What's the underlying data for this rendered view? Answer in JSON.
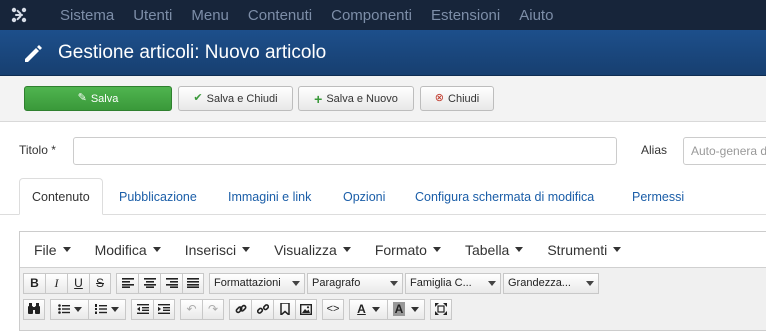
{
  "topnav": {
    "items": [
      "Sistema",
      "Utenti",
      "Menu",
      "Contenuti",
      "Componenti",
      "Estensioni",
      "Aiuto"
    ]
  },
  "header": {
    "title": "Gestione articoli: Nuovo articolo"
  },
  "toolbar": {
    "save": "Salva",
    "save_close": "Salva e Chiudi",
    "save_new": "Salva e Nuovo",
    "close": "Chiudi"
  },
  "form": {
    "title_label": "Titolo *",
    "title_value": "",
    "alias_label": "Alias",
    "alias_placeholder": "Auto-genera d"
  },
  "tabs": [
    "Contenuto",
    "Pubblicazione",
    "Immagini e link",
    "Opzioni",
    "Configura schermata di modifica",
    "Permessi"
  ],
  "editor": {
    "menu": [
      "File",
      "Modifica",
      "Inserisci",
      "Visualizza",
      "Formato",
      "Tabella",
      "Strumenti"
    ],
    "formats": "Formattazioni",
    "block": "Paragrafo",
    "font_family": "Famiglia C...",
    "font_size": "Grandezza..."
  },
  "colors": {
    "topnav_bg": "#17253a",
    "header_bg": "#1d4f8b",
    "save_green": "#3fa63f",
    "link_blue": "#1b5ea8"
  }
}
